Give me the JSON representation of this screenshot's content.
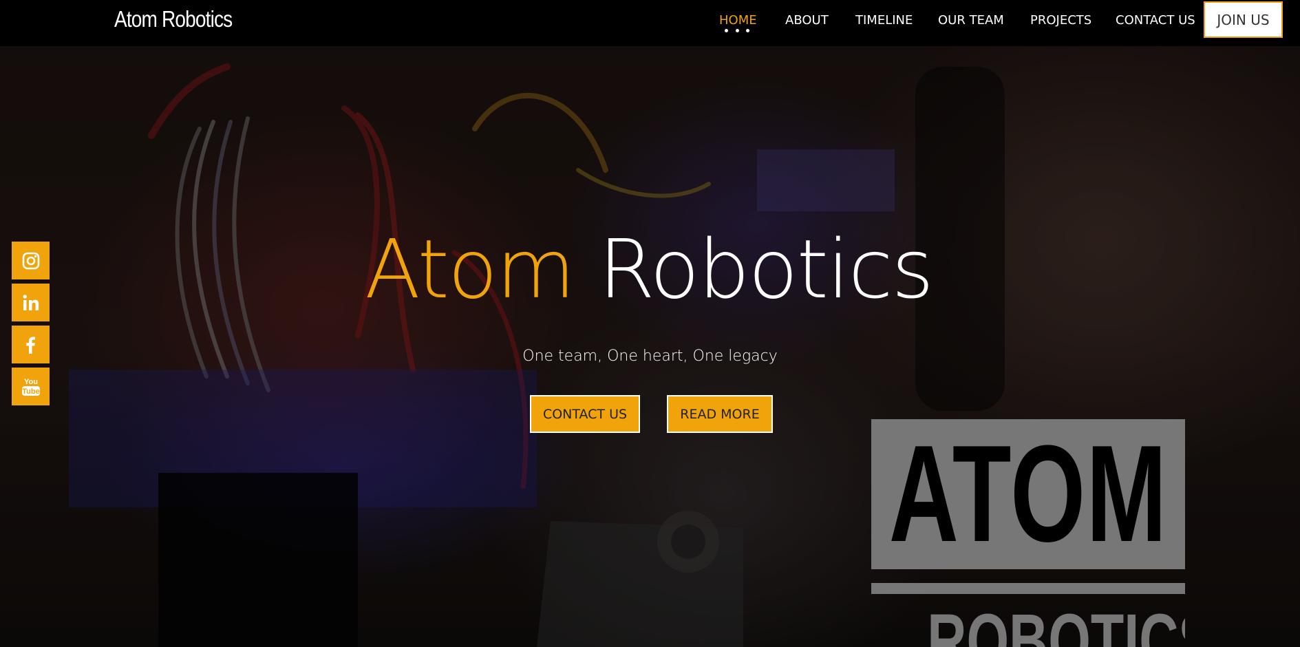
{
  "brand": {
    "name": "Atom Robotics"
  },
  "nav": {
    "items": [
      {
        "label": "HOME",
        "active": true
      },
      {
        "label": "ABOUT",
        "active": false
      },
      {
        "label": "TIMELINE",
        "active": false
      },
      {
        "label": "OUR TEAM",
        "active": false
      },
      {
        "label": "PROJECTS",
        "active": false
      },
      {
        "label": "CONTACT US",
        "active": false
      }
    ],
    "join_label": "JOIN US"
  },
  "hero": {
    "title_part1": "Atom",
    "title_part2": "Robotics",
    "subtitle": "One team, One heart, One legacy",
    "contact_label": "CONTACT US",
    "read_more_label": "READ MORE"
  },
  "social": {
    "items": [
      {
        "icon": "instagram-icon"
      },
      {
        "icon": "linkedin-icon"
      },
      {
        "icon": "facebook-icon"
      },
      {
        "icon": "youtube-icon",
        "text_top": "You",
        "text_bottom": "Tube"
      }
    ]
  },
  "logo": {
    "line1": "ATOM",
    "line2": "ROBOTICS"
  },
  "colors": {
    "accent": "#f0a30a",
    "nav_bg": "#000000",
    "logo_gray": "#777777"
  }
}
